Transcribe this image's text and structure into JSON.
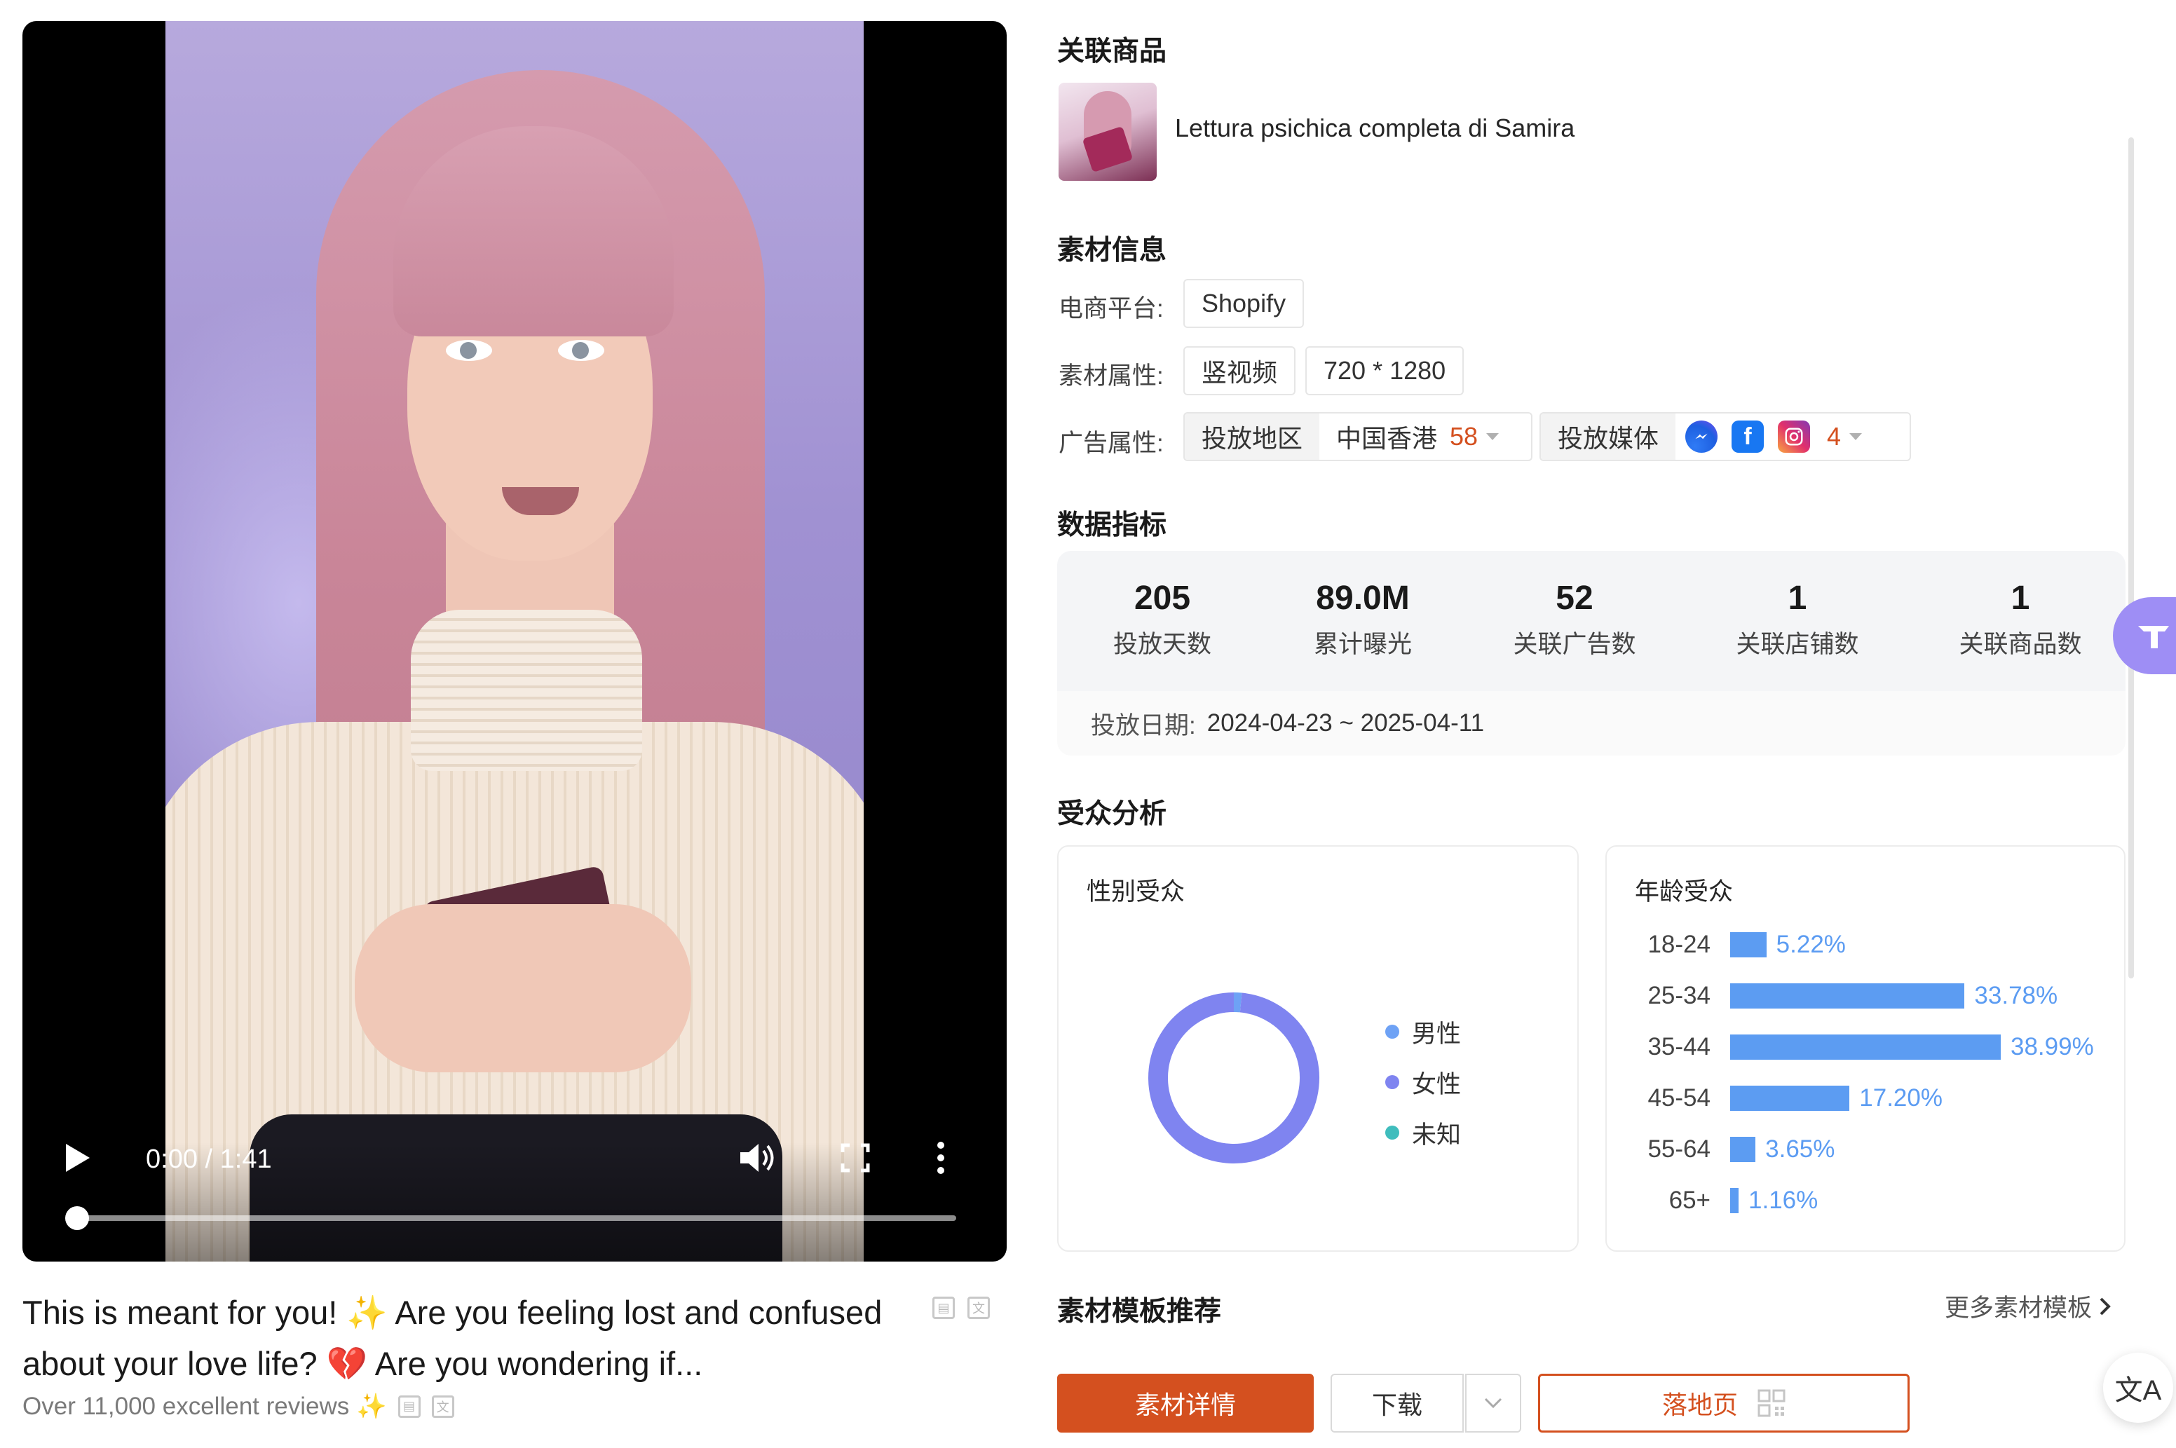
{
  "video": {
    "current_time": "0:00",
    "separator": "/",
    "duration": "1:41",
    "progress_fraction": 0.005
  },
  "caption": {
    "text": "This is meant for you! ✨ Are you feeling lost and confused about your love life? 💔 Are you wondering if...",
    "subtext": "Over 11,000 excellent reviews ✨"
  },
  "related_product": {
    "title": "关联商品",
    "name": "Lettura psichica completa di Samira"
  },
  "material_info": {
    "title": "素材信息",
    "platform_label": "电商平台:",
    "platform_value": "Shopify",
    "attr_label": "素材属性:",
    "attr_type": "竖视频",
    "attr_size": "720 * 1280",
    "ad_label": "广告属性:",
    "region_label": "投放地区",
    "region_value": "中国香港",
    "region_count": "58",
    "media_label": "投放媒体",
    "media_icons": [
      "messenger-icon",
      "facebook-icon",
      "instagram-icon"
    ],
    "media_count": "4"
  },
  "metrics": {
    "title": "数据指标",
    "items": [
      {
        "value": "205",
        "label": "投放天数"
      },
      {
        "value": "89.0M",
        "label": "累计曝光"
      },
      {
        "value": "52",
        "label": "关联广告数"
      },
      {
        "value": "1",
        "label": "关联店铺数"
      },
      {
        "value": "1",
        "label": "关联商品数"
      }
    ],
    "date_label": "投放日期:",
    "date_range": "2024-04-23 ~ 2025-04-11"
  },
  "audience": {
    "title": "受众分析",
    "gender_title": "性别受众",
    "gender_legend": [
      {
        "label": "男性",
        "color": "#6ea2f5"
      },
      {
        "label": "女性",
        "color": "#7f84f0"
      },
      {
        "label": "未知",
        "color": "#3fbdbd"
      }
    ],
    "age_title": "年龄受众"
  },
  "chart_data": [
    {
      "type": "pie",
      "title": "性别受众",
      "categories": [
        "男性",
        "女性",
        "未知"
      ],
      "values": [
        1.5,
        98.5,
        0
      ],
      "colors": [
        "#6ea2f5",
        "#7f84f0",
        "#3fbdbd"
      ]
    },
    {
      "type": "bar",
      "title": "年龄受众",
      "categories": [
        "18-24",
        "25-34",
        "35-44",
        "45-54",
        "55-64",
        "65+"
      ],
      "values": [
        5.22,
        33.78,
        38.99,
        17.2,
        3.65,
        1.16
      ],
      "labels": [
        "5.22%",
        "33.78%",
        "38.99%",
        "17.20%",
        "3.65%",
        "1.16%"
      ],
      "color": "#5c9cf2"
    }
  ],
  "templates": {
    "title": "素材模板推荐",
    "more_link": "更多素材模板"
  },
  "actions": {
    "detail": "素材详情",
    "download": "下载",
    "landing": "落地页"
  },
  "colors": {
    "accent": "#d4501f",
    "bar": "#5c9cf2",
    "float": "#9e8ef5"
  }
}
